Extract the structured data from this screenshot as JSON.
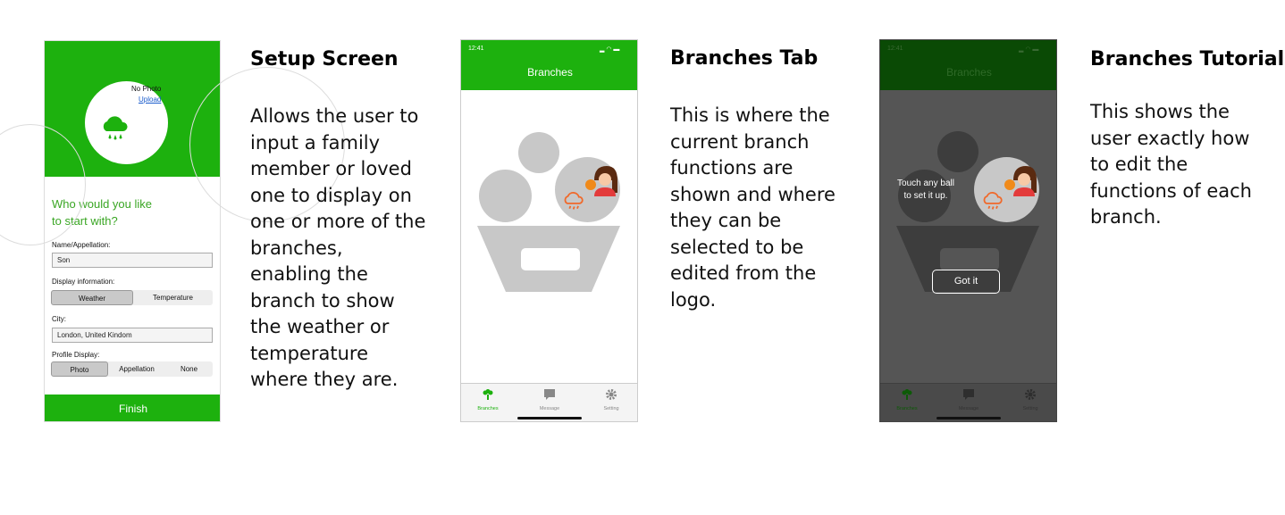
{
  "setup": {
    "no_photo": "No Photo",
    "upload": "Upload",
    "question_line1": "Who would you like",
    "question_line2": "to start with?",
    "name_label": "Name/Appellation:",
    "name_value": "Son",
    "display_label": "Display information:",
    "display_options": [
      "Weather",
      "Temperature"
    ],
    "display_selected": "Weather",
    "city_label": "City:",
    "city_value": "London, United Kindom",
    "profile_label": "Profile Display:",
    "profile_options": [
      "Photo",
      "Appellation",
      "None"
    ],
    "profile_selected": "Photo",
    "finish": "Finish"
  },
  "branches_tab": {
    "time": "12:41",
    "title": "Branches",
    "tabs": [
      "Branches",
      "Message",
      "Setting"
    ],
    "active_tab": "Branches"
  },
  "tutorial": {
    "time": "12:41",
    "title": "Branches",
    "hint_line1": "Touch any ball",
    "hint_line2": "to set it up.",
    "got_it": "Got it",
    "tabs": [
      "Branches",
      "Message",
      "Setting"
    ]
  },
  "captions": {
    "setup_title": "Setup Screen",
    "setup_lines": [
      "Allows the user to",
      "input a family",
      "member or loved",
      "one to display on",
      "one or more of the",
      "branches,",
      "enabling the",
      "branch to show",
      "the weather or",
      "temperature",
      "where they are."
    ],
    "branches_title": "Branches Tab",
    "branches_lines": [
      "This is where the",
      "current branch",
      "functions are",
      "shown and where",
      "they can be",
      "selected to be",
      "edited from the",
      "logo."
    ],
    "tutorial_title": "Branches Tutorial",
    "tutorial_lines": [
      "This shows the",
      "user exactly how",
      "to edit the",
      "functions of each",
      "branch."
    ]
  },
  "colors": {
    "brand_green": "#1db10e",
    "dark_green": "#0a4a05",
    "question_green": "#3aa624",
    "weather_orange": "#f0692a",
    "overlay_gray": "#555555"
  },
  "icons": [
    "cloud-rain-icon",
    "tree-icon",
    "message-icon",
    "gear-icon",
    "avatar-illustration"
  ]
}
